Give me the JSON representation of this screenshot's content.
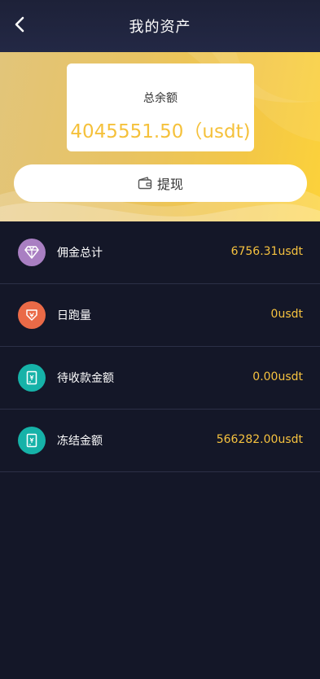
{
  "header": {
    "title": "我的资产",
    "back_icon": "chevron-left-icon"
  },
  "balance": {
    "label": "总余额",
    "value": "4045551.50（usdt)"
  },
  "withdraw": {
    "label": "提现",
    "icon": "wallet-icon"
  },
  "assets": [
    {
      "name": "佣金总计",
      "value": "6756.31usdt",
      "icon": "diamond-icon",
      "color": "#a97fc2"
    },
    {
      "name": "日跑量",
      "value": "0usdt",
      "icon": "shield-icon",
      "color": "#ea6a47"
    },
    {
      "name": "待收款金额",
      "value": "0.00usdt",
      "icon": "document-icon",
      "color": "#16b2a8"
    },
    {
      "name": "冻结金额",
      "value": "566282.00usdt",
      "icon": "document-icon",
      "color": "#16b2a8"
    }
  ],
  "colors": {
    "accent": "#f5c13b",
    "background": "#141728"
  }
}
